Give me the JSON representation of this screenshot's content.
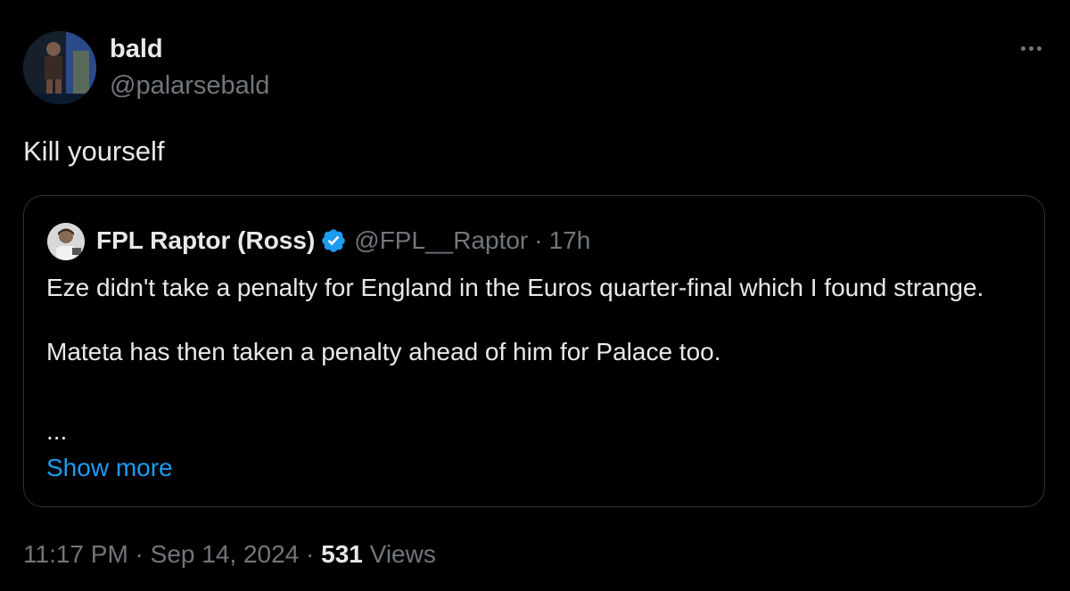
{
  "author": {
    "display_name": "bald",
    "handle": "@palarsebald",
    "avatar_icon": "profile-photo"
  },
  "more_icon": "more-horizontal-icon",
  "tweet_text": "Kill yourself",
  "quoted_tweet": {
    "display_name": "FPL Raptor (Ross)",
    "verified": true,
    "verified_icon": "verified-badge-icon",
    "handle": "@FPL__Raptor",
    "separator": "·",
    "time_ago": "17h",
    "paragraph_1": "Eze didn't take a penalty for England in the Euros quarter-final which I found strange.",
    "paragraph_2": "Mateta has then taken a penalty ahead of him for Palace too.",
    "ellipsis": "...",
    "show_more_label": "Show more"
  },
  "meta": {
    "time": "11:17 PM",
    "separator_1": " · ",
    "date": "Sep 14, 2024",
    "separator_2": " · ",
    "views_count": "531",
    "views_label": " Views"
  },
  "colors": {
    "background": "#000000",
    "primary_text": "#e7e9ea",
    "secondary_text": "#71767b",
    "link": "#1d9bf0",
    "border": "#2f3336",
    "verified": "#1d9bf0"
  }
}
